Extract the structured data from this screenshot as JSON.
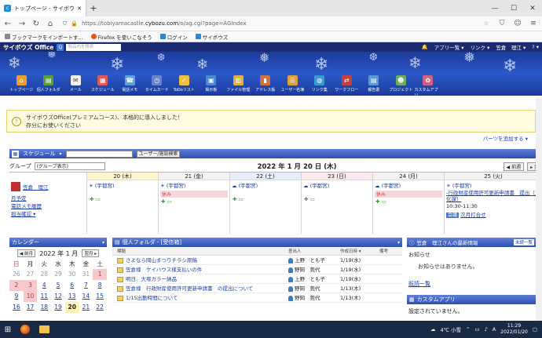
{
  "browser": {
    "tab_title": "トップページ - サイボウズ Office",
    "new_tab": "+",
    "window_controls": {
      "minimize": "—",
      "maximize": "☐",
      "close": "✕"
    },
    "url_prefix": "https://tobiyamacastle.",
    "url_domain": "cybozu.com",
    "url_suffix": "/o/ag.cgi?page=AGIndex",
    "bookmarks": [
      {
        "label": "ブックマークをインポートす...",
        "color": "#888"
      },
      {
        "label": "Firefox を使いこなそう",
        "color": "#e8541e"
      },
      {
        "label": "ログイン",
        "color": "#1d8fd6"
      },
      {
        "label": "サイボウズ",
        "color": "#1d8fd6"
      }
    ]
  },
  "cybozu": {
    "logo": "サイボウズ Office",
    "search_placeholder": "製品内を検索",
    "search_icon": "Q",
    "menu": {
      "apps": "アプリ一覧 ▾",
      "links": "リンク ▾",
      "user": "笠倉　理江 ▾",
      "help": "? ▾"
    },
    "nav_icons": [
      {
        "label": "トップページ",
        "color": "#e8a035"
      },
      {
        "label": "個人フォルダ",
        "color": "#5a9e3a"
      },
      {
        "label": "メール",
        "color": "#f0f0f0"
      },
      {
        "label": "スケジュール",
        "color": "#e05a5a"
      },
      {
        "label": "電話メモ",
        "color": "#60a0e0"
      },
      {
        "label": "タイムカード",
        "color": "#6b82c8"
      },
      {
        "label": "ToDoリスト",
        "color": "#f0c040"
      },
      {
        "label": "掲示板",
        "color": "#4a8ad0"
      },
      {
        "label": "ファイル管理",
        "color": "#e0b040"
      },
      {
        "label": "アドレス帳",
        "color": "#d07040"
      },
      {
        "label": "ユーザー名簿",
        "color": "#e0a040"
      },
      {
        "label": "リンク集",
        "color": "#3a9ad0"
      },
      {
        "label": "ワークフロー",
        "color": "#c04040"
      },
      {
        "label": "報告書",
        "color": "#5a9ad0"
      },
      {
        "label": "プロジェクト",
        "color": "#6ab060"
      },
      {
        "label": "カスタムアプリ",
        "color": "#d06080"
      }
    ]
  },
  "info": {
    "icon": "!",
    "line1": "サイボウズOffice(プレミアムコース)、本格的に導入しました！",
    "line2": "存分にお使いください",
    "parts_add": "パーツを追加する ▾"
  },
  "schedule": {
    "title": "スケジュール",
    "search_btn": "ユーザー/施設検索",
    "group_label": "グループ",
    "group_value": "(グループ表示)",
    "date_title": "2022 年 1 月 20 日 (木)",
    "nav_prev": "◀ 前週",
    "nav_next": "▸ 翌",
    "user_name": "笠倉　理江",
    "user_links": [
      "月予定",
      "電話メモ履歴",
      "担当確認 ▾"
    ],
    "days": [
      {
        "label": "20 (木)",
        "type": "today",
        "event": "(宇都宮)",
        "holiday": ""
      },
      {
        "label": "21 (金)",
        "type": "normal",
        "event": "(宇都宮)",
        "holiday": "休み"
      },
      {
        "label": "22 (土)",
        "type": "sat",
        "event": "(宇都宮)",
        "holiday": ""
      },
      {
        "label": "23 (日)",
        "type": "sun",
        "event": "(宇都宮)",
        "holiday": ""
      },
      {
        "label": "24 (月)",
        "type": "normal",
        "event": "(宇都宮)",
        "holiday": "休み"
      },
      {
        "label": "25 (火)",
        "type": "normal",
        "event": "(宇都宮)",
        "holiday": ""
      }
    ],
    "extra_event": "-行政財産使用許可更新申請書　提出（文化課）",
    "extra_time": "10:30-11:30",
    "extra_tag": "会議",
    "extra_title": "次月打合せ"
  },
  "calendar": {
    "title": "カレンダー",
    "prev": "◀ 前月",
    "next": "翌月 ▸",
    "month": "2022 年 1 月",
    "weekdays": [
      "日",
      "月",
      "火",
      "水",
      "木",
      "金",
      "土"
    ],
    "weeks": [
      [
        "26",
        "27",
        "28",
        "29",
        "30",
        "31",
        "1"
      ],
      [
        "2",
        "3",
        "4",
        "5",
        "6",
        "7",
        "8"
      ],
      [
        "9",
        "10",
        "11",
        "12",
        "13",
        "14",
        "15"
      ],
      [
        "16",
        "17",
        "18",
        "19",
        "20",
        "21",
        "22"
      ]
    ]
  },
  "folder": {
    "title": "個人フォルダ - [受信箱]",
    "columns": [
      "標題",
      "差出人",
      "作成日時 ▾",
      "備考"
    ],
    "rows": [
      {
        "title": "さよなら岡山まつりチラシ原稿",
        "sender": "上野　とも子",
        "date": "1/19(水)"
      },
      {
        "title": "笠倉様　ケイハウス様支払いの件",
        "sender": "野岡　莞代",
        "date": "1/19(水)"
      },
      {
        "title": "明日、大塚カラー納品",
        "sender": "上野　とも子",
        "date": "1/19(水)"
      },
      {
        "title": "笠倉様　行政財産使用許可更新申請書　の提出について",
        "sender": "野岡　莞代",
        "date": "1/13(木)"
      },
      {
        "title": "1/15出勤時間について",
        "sender": "野岡　莞代",
        "date": "1/13(木)"
      }
    ]
  },
  "news": {
    "title": "笠倉　理江さんの最新情報",
    "unread": "未読一覧",
    "label": "お知らせ",
    "message": "お知らせはありません。",
    "link": "既読一覧"
  },
  "customapp": {
    "title": "カスタムアプリ",
    "text": "設定されていません。"
  },
  "taskbar": {
    "weather": "4℃ 小雪",
    "ime": "A",
    "time": "11:29",
    "date": "2022/01/20"
  }
}
